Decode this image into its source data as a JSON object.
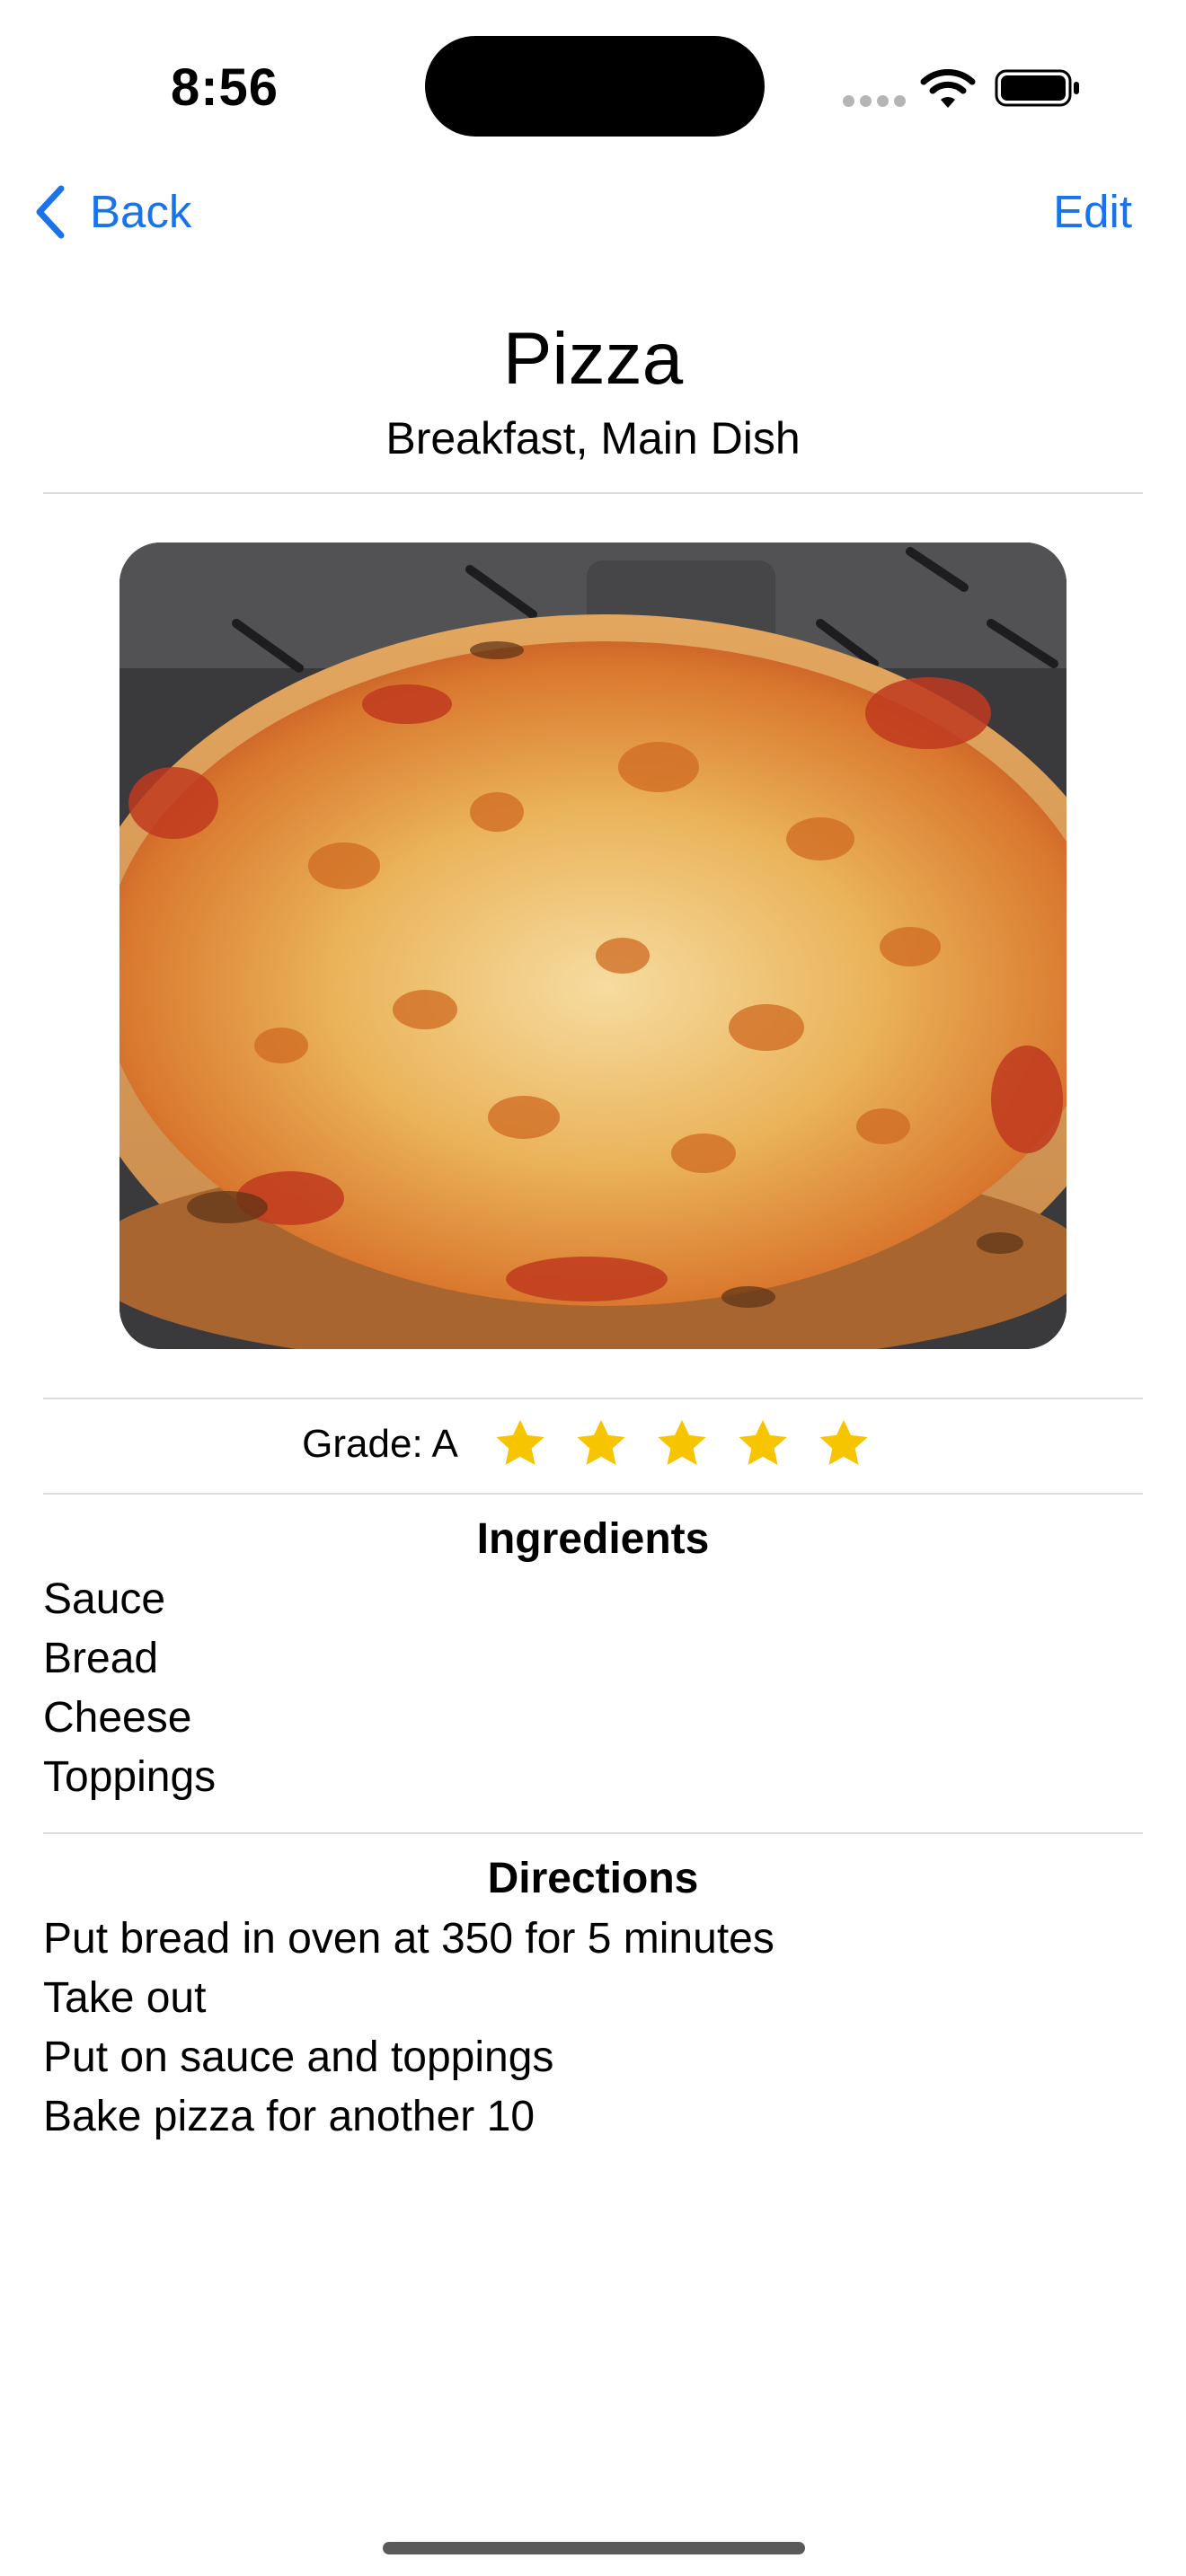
{
  "status_bar": {
    "time": "8:56",
    "wifi_icon": "wifi-icon",
    "battery_icon": "battery-full-icon"
  },
  "nav": {
    "back_label": "Back",
    "edit_label": "Edit",
    "accent_color": "#1a73e8"
  },
  "recipe": {
    "title": "Pizza",
    "categories": "Breakfast, Main Dish",
    "photo_icon": "pizza-photo",
    "grade_label": "Grade: A",
    "rating": 5,
    "rating_max": 5,
    "star_color": "#f7c500",
    "ingredients_heading": "Ingredients",
    "ingredients": [
      "Sauce",
      "Bread",
      "Cheese",
      "Toppings"
    ],
    "directions_heading": "Directions",
    "directions": [
      "Put bread in oven at 350 for 5 minutes",
      "Take out",
      "Put on sauce and toppings",
      "Bake pizza for another 10"
    ]
  }
}
